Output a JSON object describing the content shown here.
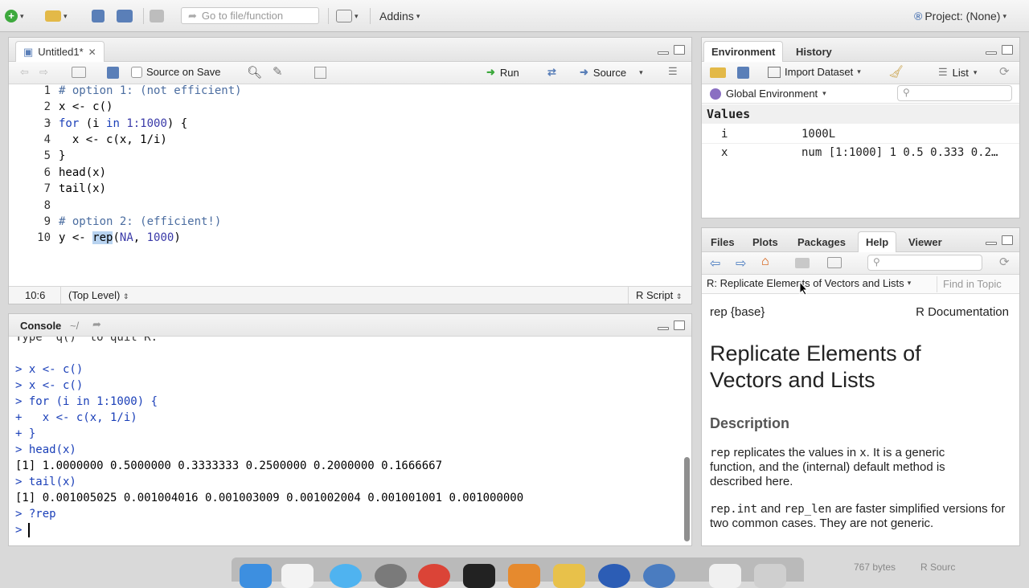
{
  "toolbar": {
    "goto_placeholder": "Go to file/function",
    "addins_label": "Addins",
    "project_label": "Project: (None)"
  },
  "editor": {
    "tab_label": "Untitled1*",
    "source_on_save_label": "Source on Save",
    "run_label": "Run",
    "source_label": "Source",
    "line_numbers": [
      "1",
      "2",
      "3",
      "4",
      "5",
      "6",
      "7",
      "8",
      "9",
      "10"
    ],
    "lines": [
      "# option 1: (not efficient)",
      "x <- c()",
      "for (i in 1:1000) {",
      "  x <- c(x, 1/i)",
      "}",
      "head(x)",
      "tail(x)",
      "",
      "# option 2: (efficient!)",
      "y <- rep(NA, 1000)"
    ],
    "status_position": "10:6",
    "status_scope": "(Top Level)",
    "status_filetype": "R Script"
  },
  "console": {
    "tab_label": "Console",
    "path": "~/",
    "lines": [
      "Type 'q()' to quit R.",
      "",
      "> x <- c()",
      "> x <- c()",
      "> for (i in 1:1000) {",
      "+   x <- c(x, 1/i)",
      "+ }",
      "> head(x)",
      "[1] 1.0000000 0.5000000 0.3333333 0.2500000 0.2000000 0.1666667",
      "> tail(x)",
      "[1] 0.001005025 0.001004016 0.001003009 0.001002004 0.001001001 0.001000000",
      "> ?rep",
      "> "
    ]
  },
  "environment": {
    "tabs": [
      "Environment",
      "History"
    ],
    "import_label": "Import Dataset",
    "list_label": "List",
    "scope_label": "Global Environment",
    "section_label": "Values",
    "rows": [
      {
        "name": "i",
        "value": "1000L"
      },
      {
        "name": "x",
        "value": "num [1:1000] 1 0.5 0.333 0.2…"
      }
    ]
  },
  "help": {
    "tabs": [
      "Files",
      "Plots",
      "Packages",
      "Help",
      "Viewer"
    ],
    "topic_label": "R: Replicate Elements of Vectors and Lists",
    "find_placeholder": "Find in Topic",
    "pkg": "rep {base}",
    "doc": "R Documentation",
    "title": "Replicate Elements of Vectors and Lists",
    "section": "Description",
    "p1_code1": "rep",
    "p1_text1": " replicates the values in ",
    "p1_code2": "x",
    "p1_text2": ". It is a generic function, and the (internal) default method is described here.",
    "p2_code1": "rep.int",
    "p2_text1": " and ",
    "p2_code2": "rep_len",
    "p2_text2": " are faster simplified versions for two common cases. They are not generic."
  },
  "dock": {
    "bytes": "767 bytes",
    "source_label": "R Sourc"
  },
  "colors": {
    "accent_blue": "#1a3fb8",
    "comment": "#4b6da0"
  }
}
